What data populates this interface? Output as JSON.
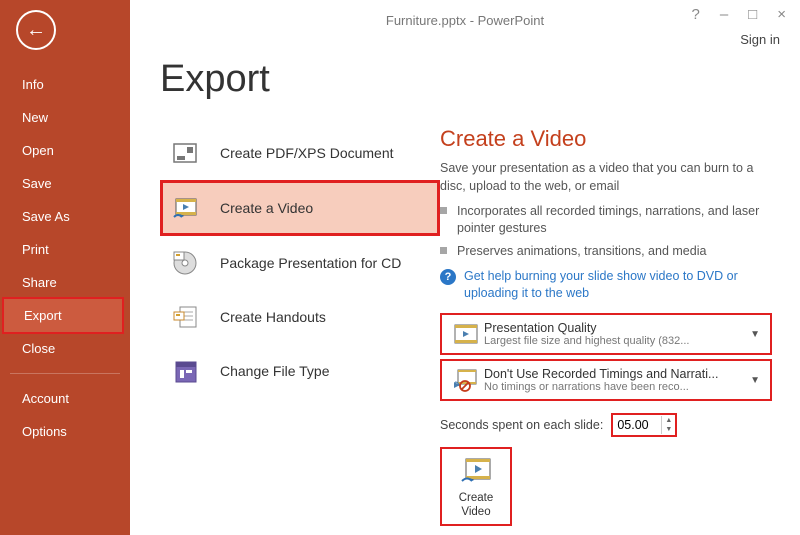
{
  "window": {
    "title": "Furniture.pptx - PowerPoint",
    "help_glyph": "?",
    "min_glyph": "–",
    "restore_glyph": "□",
    "close_glyph": "×",
    "signin": "Sign in"
  },
  "sidebar": {
    "back_arrow": "←",
    "items_top": [
      {
        "label": "Info"
      },
      {
        "label": "New"
      },
      {
        "label": "Open"
      },
      {
        "label": "Save"
      },
      {
        "label": "Save As"
      },
      {
        "label": "Print"
      },
      {
        "label": "Share"
      },
      {
        "label": "Export"
      },
      {
        "label": "Close"
      }
    ],
    "items_bottom": [
      {
        "label": "Account"
      },
      {
        "label": "Options"
      }
    ]
  },
  "page": {
    "heading": "Export",
    "options": [
      {
        "label": "Create PDF/XPS Document"
      },
      {
        "label": "Create a Video"
      },
      {
        "label": "Package Presentation for CD"
      },
      {
        "label": "Create Handouts"
      },
      {
        "label": "Change File Type"
      }
    ]
  },
  "detail": {
    "title": "Create a Video",
    "subtitle": "Save your presentation as a video that you can burn to a disc, upload to the web, or email",
    "bullets": [
      "Incorporates all recorded timings, narrations, and laser pointer gestures",
      "Preserves animations, transitions, and media"
    ],
    "help_glyph": "?",
    "help_text": "Get help burning your slide show video to DVD or uploading it to the web",
    "quality": {
      "title": "Presentation Quality",
      "sub": "Largest file size and highest quality (832..."
    },
    "timings": {
      "title": "Don't Use Recorded Timings and Narrati...",
      "sub": "No timings or narrations have been reco..."
    },
    "seconds_label": "Seconds spent on each slide:",
    "seconds_value": "05.00",
    "create_label": "Create Video"
  }
}
